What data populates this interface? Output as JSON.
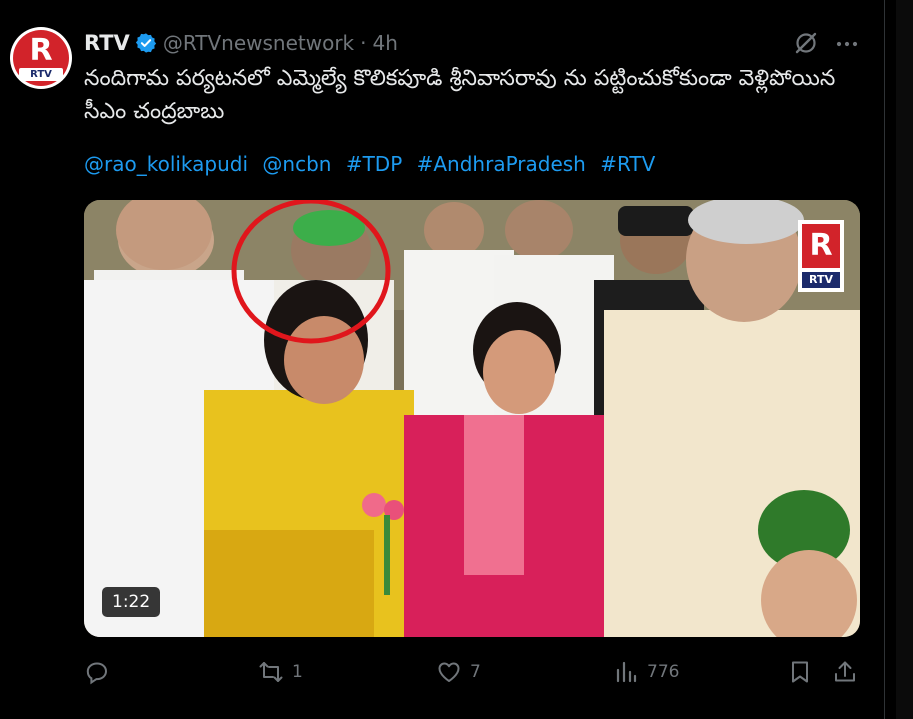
{
  "tweet": {
    "author_name": "RTV",
    "author_handle": "@RTVnewsnetwork",
    "separator": "·",
    "time": "4h",
    "text": "నందిగామ పర్యటనలో ఎమ్మెల్యే కొలికపూడి శ్రీనివాసరావు ను పట్టించుకోకుండా వెళ్లిపోయిన సీఎం చంద్రబాబు",
    "hashtags": [
      "@rao_kolikapudi",
      "@ncbn",
      "#TDP",
      "#AndhraPradesh",
      "#RTV"
    ]
  },
  "avatar": {
    "logo_letter": "R",
    "logo_text": "RTV"
  },
  "media": {
    "duration": "1:22",
    "watermark_letter": "R",
    "watermark_text": "RTV"
  },
  "actions": {
    "reply_count": "",
    "retweet_count": "1",
    "like_count": "7",
    "views_count": "776"
  },
  "colors": {
    "background": "#000000",
    "text": "#e7e9ea",
    "muted": "#71767b",
    "link": "#1d9bf0",
    "verified": "#1d9bf0",
    "brand_red": "#d2232a"
  },
  "icons": [
    "verified-badge-icon",
    "grok-icon",
    "more-icon",
    "reply-icon",
    "retweet-icon",
    "like-icon",
    "views-icon",
    "bookmark-icon",
    "share-icon"
  ]
}
